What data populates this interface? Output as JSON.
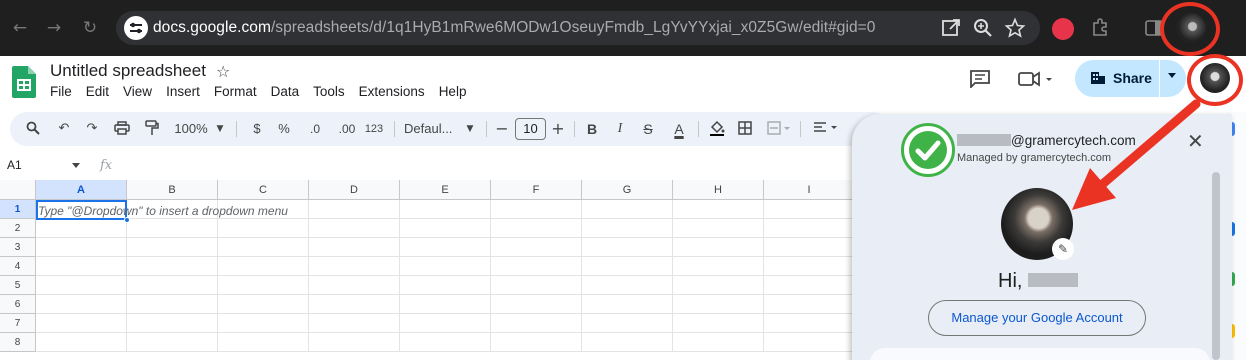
{
  "browser": {
    "url_host": "docs.google.com",
    "url_path": "/spreadsheets/d/1q1HyB1mRwe6MODw1OseuyFmdb_LgYvYYxjai_x0Z5Gw/edit#gid=0"
  },
  "header": {
    "title": "Untitled spreadsheet",
    "menus": [
      "File",
      "Edit",
      "View",
      "Insert",
      "Format",
      "Data",
      "Tools",
      "Extensions",
      "Help"
    ],
    "share_label": "Share"
  },
  "toolbar": {
    "zoom": "100%",
    "currency": "$",
    "percent": "%",
    "dec_decrease": ".0",
    "dec_increase": ".00",
    "number_format": "123",
    "font": "Defaul...",
    "font_size": "10",
    "bold": "B",
    "italic": "I",
    "strike": "S",
    "text_color": "A"
  },
  "formula_bar": {
    "cell_ref": "A1",
    "fx": "fx"
  },
  "grid": {
    "columns": [
      "A",
      "B",
      "C",
      "D",
      "E",
      "F",
      "G",
      "H",
      "I"
    ],
    "rows": [
      "1",
      "2",
      "3",
      "4",
      "5",
      "6",
      "7",
      "8"
    ],
    "hint": "Type \"@Dropdown\"  to insert a dropdown menu"
  },
  "account_panel": {
    "email_suffix": "@gramercytech.com",
    "managed_by": "Managed by gramercytech.com",
    "greeting": "Hi,",
    "manage_button": "Manage your Google Account"
  },
  "colors": {
    "annotation_red": "#ea3323",
    "check_green": "#3fb348",
    "share_bg": "#c2e7ff",
    "accent_blue": "#1a73e8"
  }
}
